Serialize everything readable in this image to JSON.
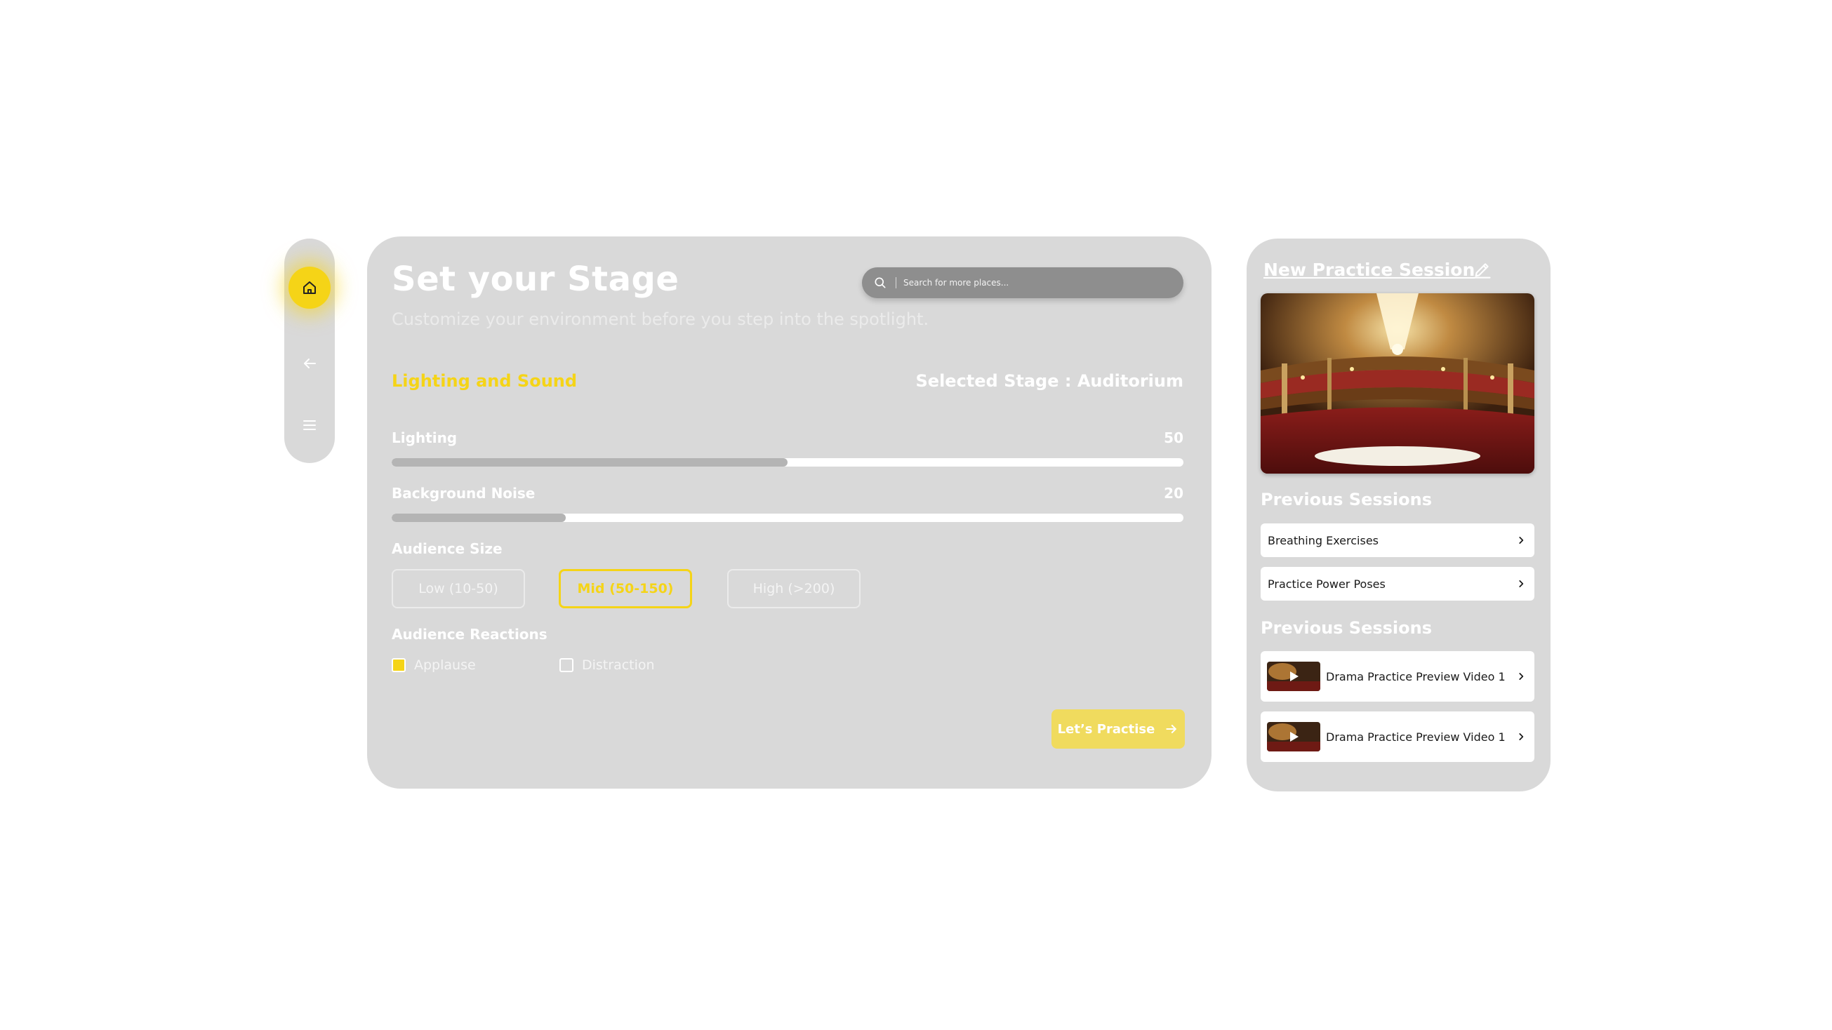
{
  "rail": {
    "items": [
      {
        "icon": "home-icon",
        "active": true
      },
      {
        "icon": "arrow-left-icon",
        "active": false
      },
      {
        "icon": "menu-icon",
        "active": false
      }
    ],
    "accent": "#f5d417"
  },
  "main": {
    "title": "Set your Stage",
    "subtitle": "Customize your environment before you step into the spotlight.",
    "search": {
      "placeholder": "Search for more places..."
    },
    "section_title": "Lighting and Sound",
    "selected_stage": "Selected Stage : Auditorium",
    "sliders": [
      {
        "label": "Lighting",
        "value": "50",
        "fraction": 0.5
      },
      {
        "label": "Background Noise",
        "value": "20",
        "fraction": 0.22
      }
    ],
    "audience_size": {
      "label": "Audience Size",
      "options": [
        "Low (10-50)",
        "Mid (50-150)",
        "High (>200)"
      ],
      "selected": "Mid (50-150)"
    },
    "audience_reactions": {
      "label": "Audience Reactions",
      "options": [
        {
          "label": "Applause",
          "checked": true
        },
        {
          "label": "Distraction",
          "checked": false
        }
      ]
    },
    "cta": {
      "label": "Let’s Practise",
      "icon": "arrow-right-icon"
    }
  },
  "side": {
    "title": "New Practice Session",
    "edit_icon": "pencil-icon",
    "hero_image": "auditorium-photo",
    "previous_sessions_heading": "Previous Sessions",
    "previous_sessions": [
      "Breathing Exercises",
      "Practice Power Poses"
    ],
    "videos_heading": "Previous Sessions",
    "videos": [
      "Drama Practice Preview Video 1",
      "Drama Practice Preview Video 1"
    ]
  },
  "colors": {
    "panel": "#d9d9d9",
    "accent": "#f5d417",
    "cta": "#f0db5e",
    "search": "#8e8e8e"
  }
}
